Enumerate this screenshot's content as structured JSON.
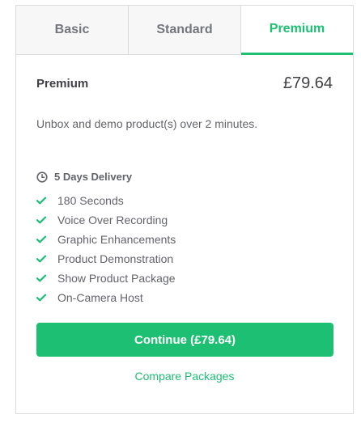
{
  "tabs": [
    {
      "label": "Basic"
    },
    {
      "label": "Standard"
    },
    {
      "label": "Premium"
    }
  ],
  "package": {
    "name": "Premium",
    "price": "£79.64",
    "description": "Unbox and demo product(s) over 2 minutes.",
    "delivery": "5 Days Delivery",
    "features": [
      "180 Seconds",
      "Voice Over Recording",
      "Graphic Enhancements",
      "Product Demonstration",
      "Show Product Package",
      "On-Camera Host"
    ]
  },
  "actions": {
    "continue_label": "Continue (£79.64)",
    "compare_label": "Compare Packages"
  },
  "colors": {
    "accent": "#1dbf73",
    "text": "#404145",
    "muted": "#62646a"
  },
  "icons": {
    "delivery": "clock-icon",
    "feature": "check-icon"
  }
}
